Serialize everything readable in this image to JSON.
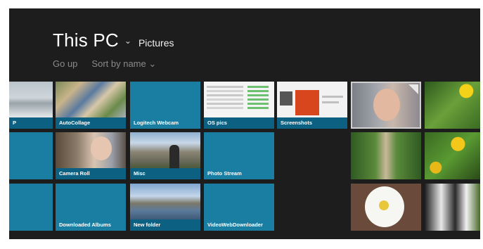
{
  "header": {
    "title": "This PC",
    "chevron_icon": "chevron-down-icon",
    "location": "Pictures"
  },
  "commands": {
    "go_up": "Go up",
    "sort_by": "Sort by name ⌄"
  },
  "folders": {
    "partial": "P",
    "autocollage": "AutoCollage",
    "logitech_webcam": "Logitech Webcam",
    "os_pics": "OS pics",
    "screenshots": "Screenshots",
    "camera_roll": "Camera Roll",
    "misc": "Misc",
    "photo_stream": "Photo Stream",
    "downloaded_albums": "Downloaded Albums",
    "new_folder": "New folder",
    "videowebdownloader": "VideoWebDownloader"
  },
  "colors": {
    "background": "#1d1d1d",
    "tile": "#1a7ea3",
    "label_band": "#0a5a7d"
  }
}
